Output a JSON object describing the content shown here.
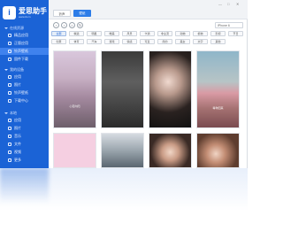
{
  "app": {
    "logo_glyph": "i",
    "title": "爱思助手",
    "subtitle": "www.i4.cn"
  },
  "sidebar": {
    "sections": [
      {
        "label": "在线资源"
      },
      {
        "label": "我的设备"
      },
      {
        "label": "本地"
      }
    ],
    "items": [
      {
        "label": "精品应用"
      },
      {
        "label": "正版应用"
      },
      {
        "label": "铃声壁纸",
        "active": true
      },
      {
        "label": "固件下载"
      },
      {
        "label": "应用"
      },
      {
        "label": "照片"
      },
      {
        "label": "铃声壁纸"
      },
      {
        "label": "下载中心"
      },
      {
        "label": "应用"
      },
      {
        "label": "照片"
      },
      {
        "label": "音乐"
      },
      {
        "label": "文件"
      },
      {
        "label": "视频"
      },
      {
        "label": "更多"
      }
    ]
  },
  "topbar": {
    "tabs": [
      {
        "label": "铃声"
      },
      {
        "label": "壁纸"
      }
    ],
    "window_controls": [
      "—",
      "□",
      "✕"
    ]
  },
  "navbar": {
    "back": "‹",
    "forward": "›",
    "home": "⌂",
    "refresh": "↻",
    "device_label": "iPhone 6"
  },
  "tags": [
    [
      "全部",
      "精选",
      "明星",
      "唯美",
      "风景",
      "卡通",
      "非主流",
      "动物",
      "植物",
      "影视",
      "节日"
    ],
    [
      "创意",
      "体育",
      "汽车",
      "游戏",
      "情感",
      "可爱",
      "简约",
      "美女",
      "文字",
      "其他"
    ]
  ],
  "photos": [
    {
      "caption": "心若向阳"
    },
    {
      "caption": ""
    },
    {
      "caption": ""
    },
    {
      "caption": "等你回来"
    },
    {
      "caption": ""
    },
    {
      "caption": ""
    },
    {
      "caption": ""
    },
    {
      "caption": ""
    }
  ],
  "colors": {
    "sidebar": "#1b63d6",
    "active_item": "#3f82ee",
    "accent": "#2c7ce8"
  }
}
